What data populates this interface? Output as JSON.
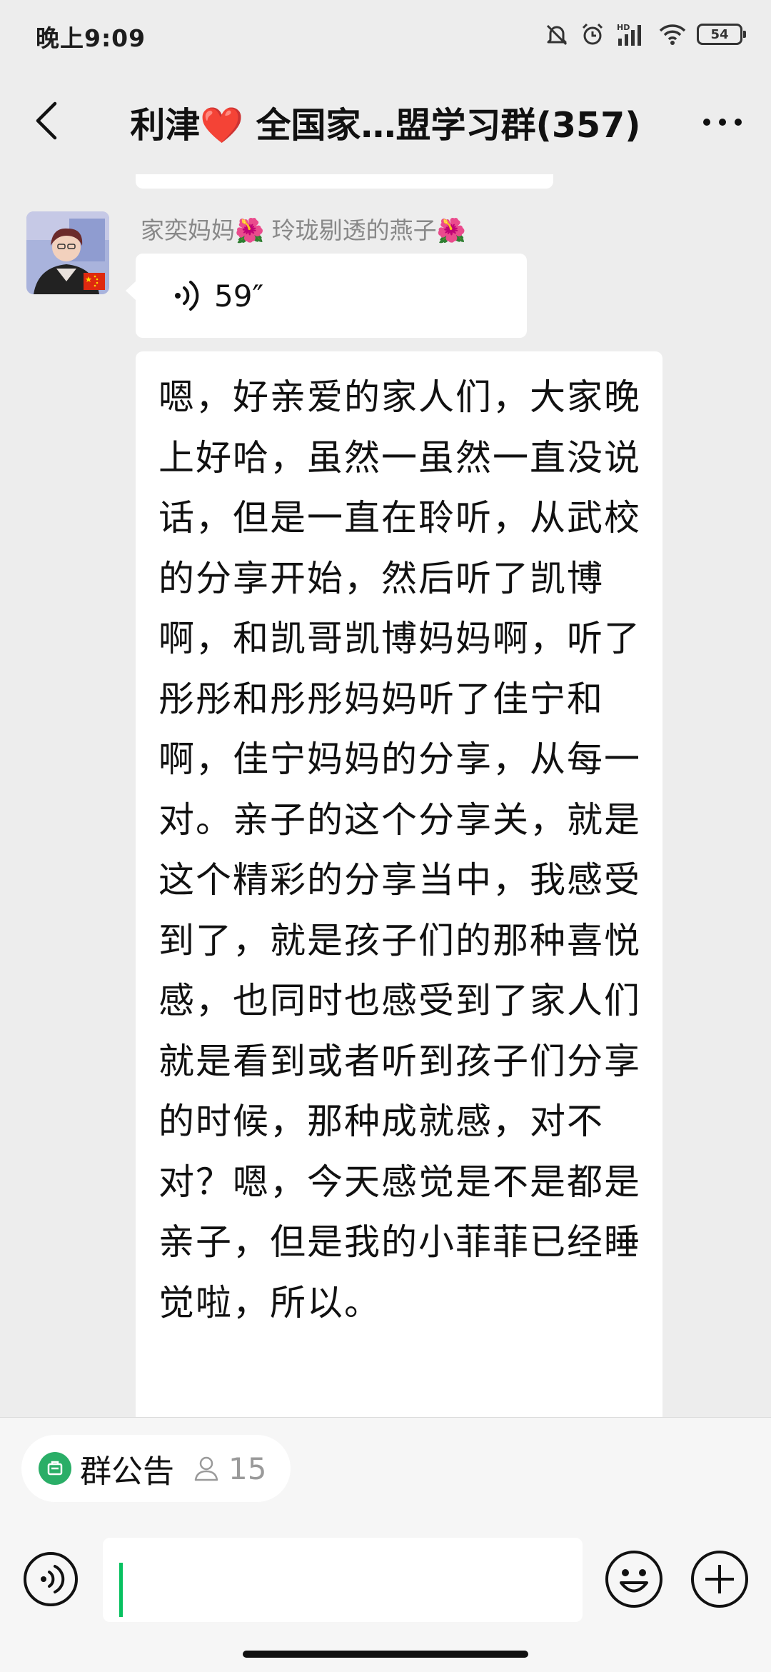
{
  "status_bar": {
    "time": "晚上9:09",
    "battery": "54",
    "network": "HD"
  },
  "header": {
    "title_prefix": "利津",
    "title_heart": "❤️",
    "title_suffix": " 全国家…盟学习群(357)"
  },
  "message": {
    "sender_name_1": "家奕妈妈",
    "sender_flower_1": "🌺",
    "sender_name_2": " 玲珑剔透的燕子",
    "sender_flower_2": "🌺",
    "voice_duration": "59″",
    "transcript": "嗯，好亲爱的家人们，大家晚上好哈，虽然一虽然一直没说话，但是一直在聆听，从武校的分享开始，然后听了凯博啊，和凯哥凯博妈妈啊，听了彤彤和彤彤妈妈听了佳宁和啊，佳宁妈妈的分享，从每一对。亲子的这个分享关，就是这个精彩的分享当中，我感受到了，就是孩子们的那种喜悦感，也同时也感受到了家人们就是看到或者听到孩子们分享的时候，那种成就感，对不对？嗯，今天感觉是不是都是亲子，但是我的小菲菲已经睡觉啦，所以。"
  },
  "bottom": {
    "notice_label": "群公告",
    "member_count": "15",
    "input_value": "",
    "accent_color": "#07c160"
  }
}
